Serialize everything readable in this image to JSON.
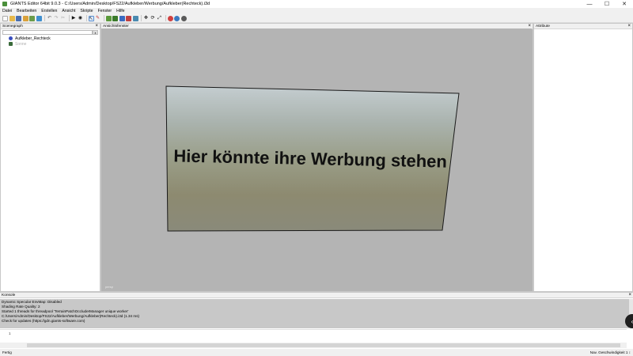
{
  "window": {
    "title": "GIANTS Editor 64bit 9.0.3 - C:/Users/Admin/Desktop/FS22/Aufkleber/Werbung/Aufkleber(Rechteck).i3d",
    "controls": {
      "minimize": "—",
      "maximize": "☐",
      "close": "✕"
    }
  },
  "menu": [
    "Datei",
    "Bearbeiten",
    "Erstellen",
    "Ansicht",
    "Skripte",
    "Fenster",
    "Hilfe"
  ],
  "toolbar": {
    "icons": [
      "new-file-icon",
      "open-icon",
      "save-icon",
      "import-icon",
      "export-icon",
      "refresh-icon",
      "undo-icon",
      "redo-icon",
      "play-icon",
      "eye-icon",
      "select-icon",
      "paint-icon",
      "terrain-icon",
      "foliage-icon",
      "layer-icon",
      "move-icon",
      "rotate-icon",
      "scale-icon",
      "camera-icon",
      "settings-icon",
      "globe-icon"
    ]
  },
  "scenegraph": {
    "title": "Scenegraph",
    "search_placeholder": "",
    "search_button": "x",
    "items": [
      {
        "label": "Aufkleber_Rechteck",
        "icon": "shape-icon",
        "color": "#3b4fbf"
      },
      {
        "label": "Sonne",
        "icon": "light-icon",
        "color": "#888888"
      }
    ]
  },
  "viewport": {
    "title": "Ansichtsfenster",
    "camera_label": "persp",
    "sign_text": "Hier könnte ihre Werbung stehen"
  },
  "attributes": {
    "title": "Attribute"
  },
  "console": {
    "title": "Konsole",
    "lines": [
      "  Dynamic Specular EnvMap: Disabled",
      "  Shading Rate Quality: 2",
      "Started 1 threads for threadpool 'TerrainPatchOccluderManager unique worker'",
      "C:/Users/Admin/Desktop/FS22/Aufkleber/Werbung/Aufkleber(Rechteck).i3d (1.34 ms)",
      "Check for updates (https://gdn.giants-software.com)"
    ],
    "input_line_number": "1"
  },
  "status": {
    "left": "Fertig",
    "right": "Nav. Geschwindigkeit 1 ↕"
  },
  "colors": {
    "viewport_bg": "#b4b4b4",
    "console_bg": "#c8c8c8"
  }
}
